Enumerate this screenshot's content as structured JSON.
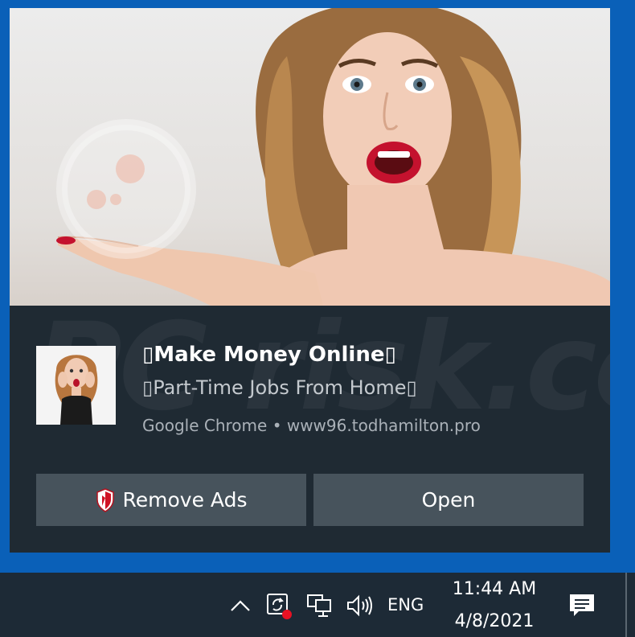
{
  "notification": {
    "title": "▯Make Money Online▯",
    "subtitle": "▯Part-Time Jobs From Home▯",
    "source": "Google Chrome • www96.todhamilton.pro",
    "hero_image": "woman-pointing-photo",
    "thumbnail_image": "surprised-woman-photo",
    "buttons": {
      "remove_ads": {
        "label": "Remove Ads",
        "icon": "shield-icon"
      },
      "open": {
        "label": "Open"
      }
    }
  },
  "taskbar": {
    "icons": [
      "chevron-up-icon",
      "sync-icon",
      "network-icon",
      "volume-icon",
      "action-center-icon"
    ],
    "language": "ENG",
    "time": "11:44 AM",
    "date": "4/8/2021"
  },
  "colors": {
    "desktop": "#0a60b8",
    "toast_bg": "#1f2a33",
    "button_bg": "#47535c",
    "taskbar_bg": "#1d2a36",
    "alert_dot": "#e81123"
  }
}
